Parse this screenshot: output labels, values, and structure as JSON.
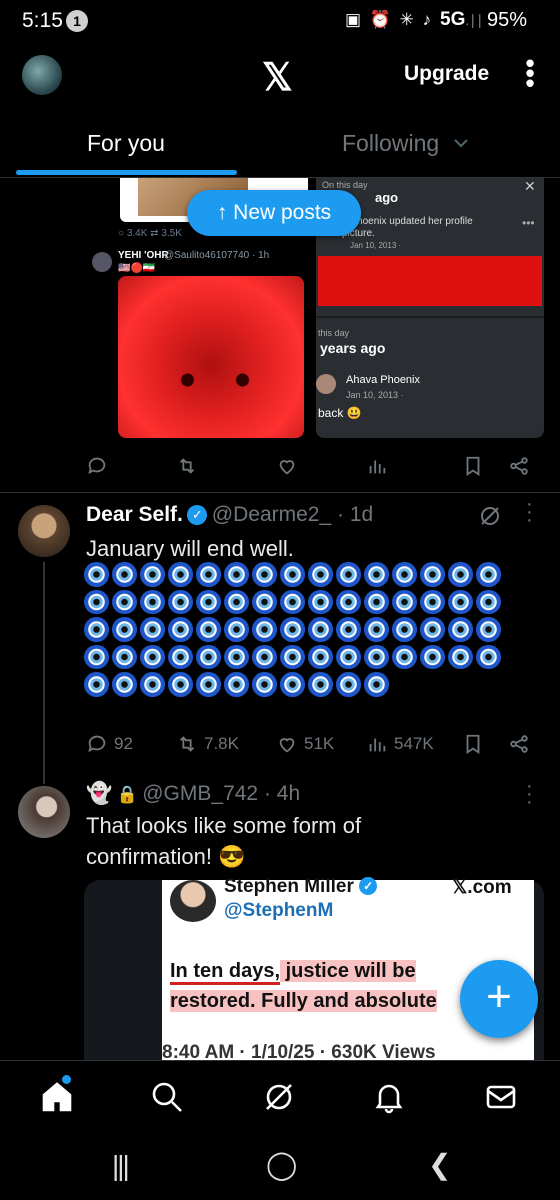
{
  "status_bar": {
    "time": "5:15",
    "notif_count": "1",
    "icons": "▣ ⏰ ✳ ♪",
    "network": "5G",
    "signal": ".∣∣",
    "battery": "95%"
  },
  "header": {
    "logo": "𝕏",
    "upgrade_label": "Upgrade",
    "more": "⋮"
  },
  "tabs": [
    {
      "label": "For you"
    },
    {
      "label": "Following"
    }
  ],
  "new_posts_label": "↑ New posts",
  "collage": {
    "stats": "○ 3.4K  ⇄ 3.5K",
    "author": "YEHI 'OHR",
    "author_handle": "@Saulito46107740 · 1h",
    "flags": "🇺🇸🔴🇮🇷",
    "fb_on_this_day": "On this day",
    "fb_ago1": "ago",
    "fb_line1": "a Phoenix updated her profile",
    "fb_line2": "picture.",
    "fb_date1": "Jan 10, 2013 ·",
    "fb_this_day2": "this day",
    "fb_ago2": "years ago",
    "fb_name2": "Ahava Phoenix",
    "fb_date2": "Jan 10, 2013 ·",
    "fb_back": "back 😃"
  },
  "posts": [
    {
      "name": "Dear Self.",
      "handle": "@Dearme2_ · 1d",
      "text": "January will end well.",
      "nazar_rows": [
        15,
        15,
        15,
        15,
        11
      ],
      "replies": "92",
      "reposts": "7.8K",
      "likes": "51K",
      "views": "547K"
    },
    {
      "name_emoji": "👻",
      "lock": "🔒",
      "handle": "@GMB_742 · 4h",
      "text_line1": "That looks like some form of",
      "text_line2": "confirmation! 😎",
      "embed": {
        "name": "Stephen Miller",
        "xcom": "𝕏.com",
        "handle": "@StephenM",
        "line1_a": "In ten days,",
        "line1_b": " justice will be",
        "line2_a": "restored.",
        "line2_b": " Fully and absolute",
        "footer": "8:40 AM · 1/10/25 · 630K Views"
      }
    }
  ],
  "fab_label": "+",
  "system_nav": {
    "recents": "|||",
    "home": "◯",
    "back": "❮"
  }
}
